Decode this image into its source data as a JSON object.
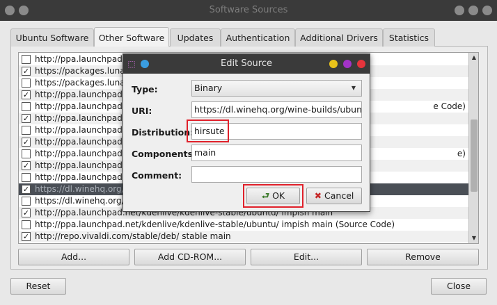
{
  "window": {
    "title": "Software Sources"
  },
  "tabs": [
    {
      "label": "Ubuntu Software"
    },
    {
      "label": "Other Software"
    },
    {
      "label": "Updates"
    },
    {
      "label": "Authentication"
    },
    {
      "label": "Additional Drivers"
    },
    {
      "label": "Statistics"
    }
  ],
  "sources": [
    {
      "checked": false,
      "text": "http://ppa.launchpad.n"
    },
    {
      "checked": true,
      "text": "https://packages.lunar"
    },
    {
      "checked": false,
      "text": "https://packages.lunar"
    },
    {
      "checked": true,
      "text": "http://ppa.launchpad.n"
    },
    {
      "checked": false,
      "text": "http://ppa.launchpad.n",
      "tail": "e Code)"
    },
    {
      "checked": true,
      "text": "http://ppa.launchpad.n"
    },
    {
      "checked": false,
      "text": "http://ppa.launchpad.n"
    },
    {
      "checked": true,
      "text": "http://ppa.launchpad.n"
    },
    {
      "checked": false,
      "text": "http://ppa.launchpad.n",
      "tail": "e)"
    },
    {
      "checked": true,
      "text": "http://ppa.launchpad.n"
    },
    {
      "checked": false,
      "text": "http://ppa.launchpad.n"
    },
    {
      "checked": true,
      "text": "https://dl.winehq.org/"
    },
    {
      "checked": false,
      "text": "https://dl.winehq.org/"
    },
    {
      "checked": true,
      "text": "http://ppa.launchpad.net/kdenlive/kdenlive-stable/ubuntu/ impish main"
    },
    {
      "checked": false,
      "text": "http://ppa.launchpad.net/kdenlive/kdenlive-stable/ubuntu/ impish main (Source Code)"
    },
    {
      "checked": true,
      "text": "http://repo.vivaldi.com/stable/deb/ stable main"
    }
  ],
  "buttons": {
    "add": "Add...",
    "add_cdrom": "Add CD-ROM...",
    "edit": "Edit...",
    "remove": "Remove",
    "reset": "Reset",
    "close": "Close"
  },
  "dialog": {
    "title": "Edit Source",
    "type_label": "Type:",
    "type_value": "Binary",
    "uri_label": "URI:",
    "uri_value": "https://dl.winehq.org/wine-builds/ubuntu/",
    "distribution_label": "Distribution:",
    "distribution_value": "hirsute",
    "components_label": "Components:",
    "components_value": "main",
    "comment_label": "Comment:",
    "comment_value": "",
    "ok_label": "OK",
    "cancel_label": "Cancel"
  },
  "colors": {
    "dot_yellow": "#e8c21a",
    "dot_purple": "#a333c8",
    "dot_red": "#e5343c",
    "dot_blue": "#3a9de0",
    "highlight": "#e0202a"
  }
}
